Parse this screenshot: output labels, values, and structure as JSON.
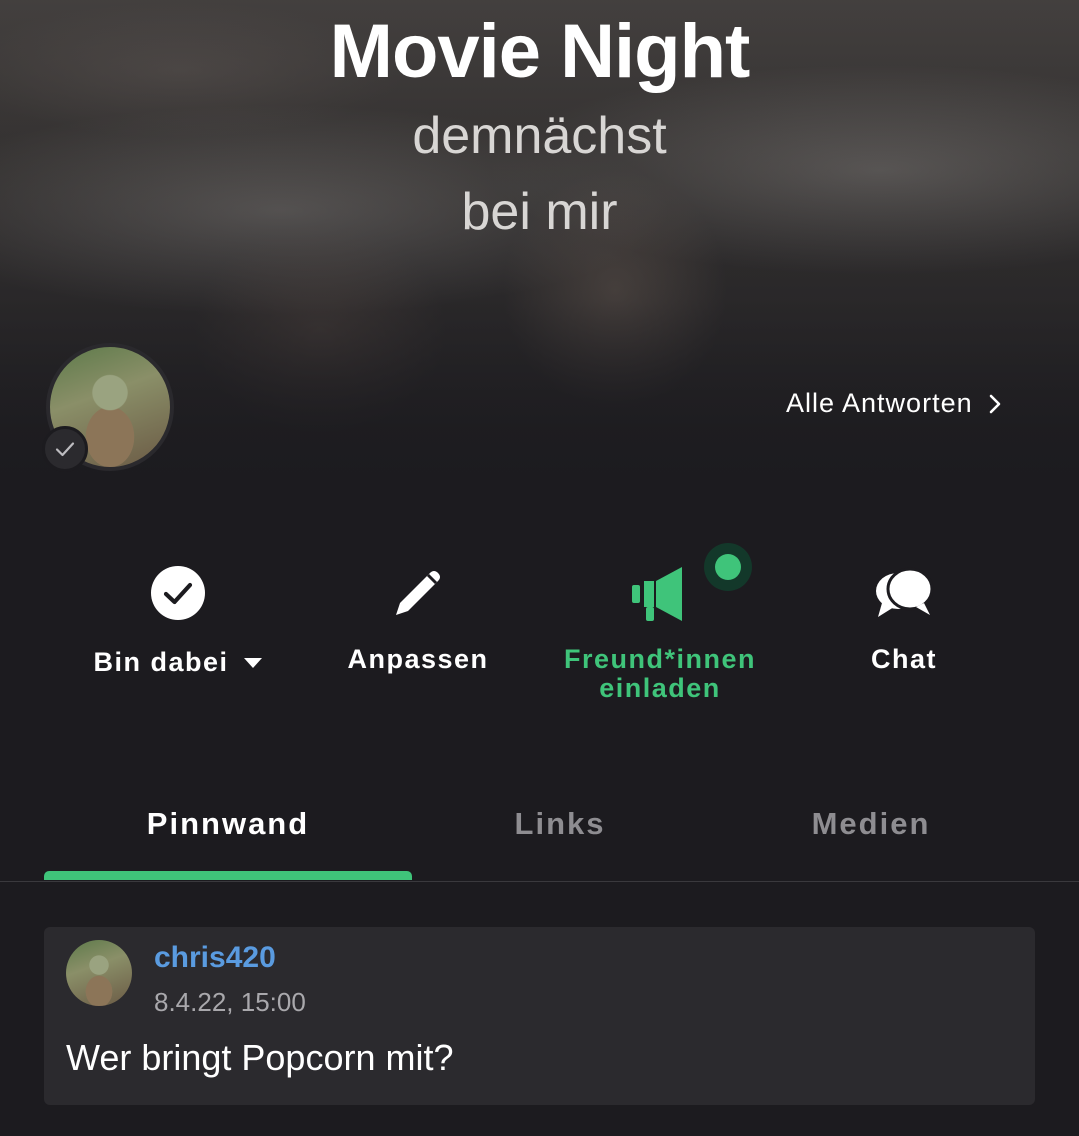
{
  "event": {
    "title": "Movie Night",
    "subtitle_line1": "demnächst",
    "subtitle_line2": "bei mir"
  },
  "header": {
    "all_answers_label": "Alle Antworten",
    "avatar_status_icon": "check-icon"
  },
  "actions": {
    "attend_label": "Bin dabei",
    "edit_label": "Anpassen",
    "invite_label_line1": "Freund*innen",
    "invite_label_line2": "einladen",
    "chat_label": "Chat",
    "invite_badge": "notification-dot",
    "accent_color": "#3fc47a"
  },
  "tabs": [
    {
      "label": "Pinnwand",
      "active": true
    },
    {
      "label": "Links",
      "active": false
    },
    {
      "label": "Medien",
      "active": false
    }
  ],
  "posts": [
    {
      "username": "chris420",
      "timestamp": "8.4.22, 15:00",
      "text": "Wer bringt Popcorn mit?",
      "username_color": "#5a9be0"
    }
  ]
}
